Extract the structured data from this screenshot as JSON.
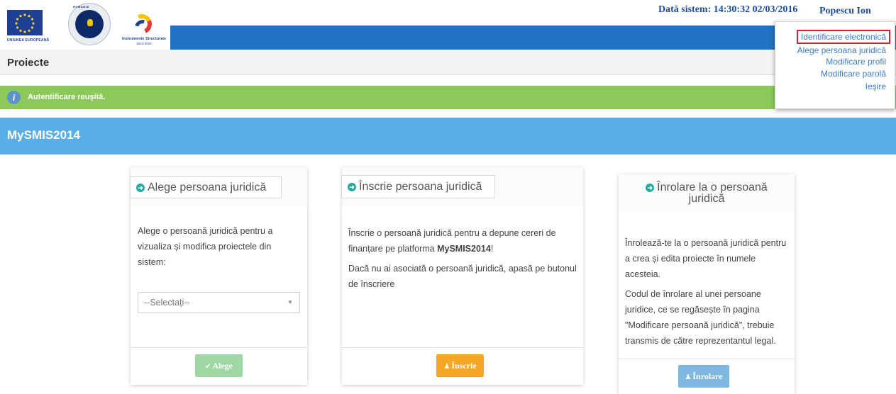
{
  "header": {
    "logos": {
      "eu_label": "UNIUNEA EUROPEANĂ",
      "ro_banner": "ROMANIA",
      "is_line1": "Instrumente Structurale",
      "is_line2": "2014-2020"
    },
    "system_date": "Dată sistem: 14:30:32 02/03/2016",
    "user_name": "Popescu Ion",
    "page_title": "Proiecte",
    "band_color": "#1f72c4"
  },
  "user_menu": {
    "items": [
      {
        "label": "Identificare electronică",
        "highlighted": true
      },
      {
        "label": "Alege persoana juridică"
      },
      {
        "label": "Modificare profil"
      },
      {
        "label": "Modificare parolă"
      },
      {
        "label": "Ieşire"
      }
    ]
  },
  "alert": {
    "icon": "info-icon",
    "message": "Autentificare reuşită.",
    "color": "#8dc95a"
  },
  "section": {
    "title": "MySMIS2014",
    "color": "#5aaee8"
  },
  "cards": [
    {
      "title": "Alege persoana juridică",
      "icon": "circle-arrow-right-icon",
      "body": [
        "Alege o persoană juridică pentru a vizualiza și modifica proiectele din sistem:"
      ],
      "select": {
        "value": "--Selectați--",
        "caret": "▼"
      },
      "button": {
        "label": "Alege",
        "icon": "check-icon",
        "glyph": "✔",
        "color": "#9fd7a4"
      }
    },
    {
      "title": "Înscrie persoana juridică",
      "icon": "circle-arrow-right-icon",
      "body_pre": "Înscrie o persoană juridică pentru a depune cereri de finanțare pe platforma ",
      "body_strong": "MySMIS2014",
      "body_post": "!",
      "body2": "Dacă nu ai asociată o persoană juridică, apasă pe butonul de înscriere",
      "button": {
        "label": "Înscrie",
        "icon": "user-icon",
        "glyph": "♟",
        "color": "#f5a623"
      }
    },
    {
      "title_line1": "Înrolare la o persoană",
      "title_line2": "juridică",
      "icon": "circle-arrow-right-icon",
      "body": [
        "Înrolează-te la o persoană juridică pentru a crea și edita proiecte în numele acesteia.",
        "Codul de înrolare al unei persoane juridice, ce se regăsește în pagina \"Modificare persoană juridică\", trebuie transmis de către reprezentantul legal."
      ],
      "button": {
        "label": "Înrolare",
        "icon": "user-icon",
        "glyph": "♟",
        "color": "#7fb7e0"
      }
    }
  ]
}
